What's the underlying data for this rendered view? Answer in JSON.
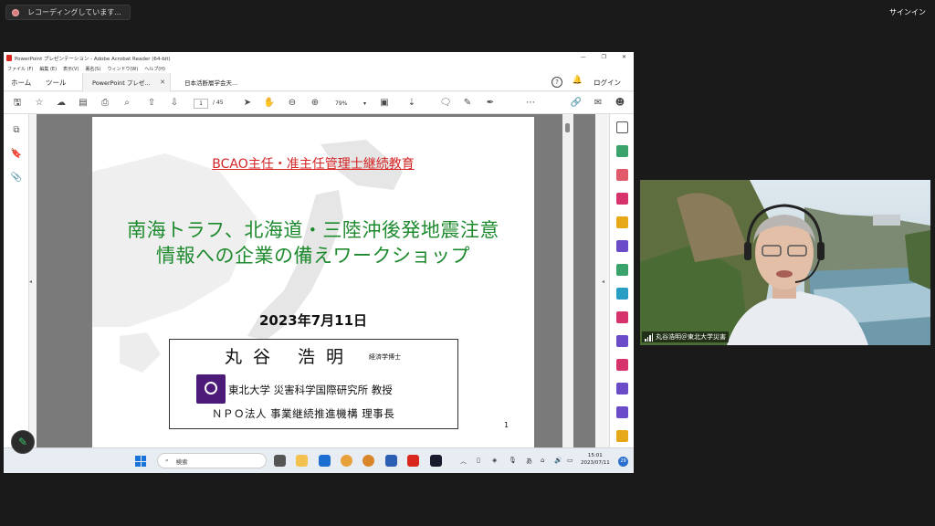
{
  "zoom": {
    "recording_label": "レコーディングしています...",
    "signin_label": "サインイン",
    "participant_name": "丸谷浩明＠東北大学災害"
  },
  "acrobat": {
    "window_title": "PowerPoint プレゼンテーション - Adobe Acrobat Reader (64-bit)",
    "menus": [
      "ファイル (F)",
      "編集 (E)",
      "表示(V)",
      "署名(S)",
      "ウィンドウ(W)",
      "ヘルプ(H)"
    ],
    "tabs": {
      "home": "ホーム",
      "tools": "ツール",
      "doc1": "PowerPoint プレゼ...",
      "doc2": "日本活断層学会天..."
    },
    "login_label": "ログイン",
    "help_glyph": "?",
    "page_current": "1",
    "page_total": "/ 45",
    "zoom_level": "79%"
  },
  "slide": {
    "subtitle": "BCAO主任・准主任管理士継続教育",
    "title_line1": "南海トラフ、北海道・三陸沖後発地震注意",
    "title_line2": "情報への企業の備えワークショップ",
    "date": "2023年7月11日",
    "presenter_name": "丸谷 浩明",
    "presenter_degree": "経済学博士",
    "affiliation1": "東北大学 災害科学国際研究所 教授",
    "affiliation2": "ＮＰＯ法人 事業継続推進機構 理事長",
    "page_number": "1"
  },
  "taskbar": {
    "search_label": "検索",
    "time": "15:01",
    "date": "2023/07/11",
    "notification_count": "29",
    "ime_label": "あ"
  },
  "colors": {
    "subtitle_red": "#d42424",
    "title_green": "#1d8a2e",
    "univ_purple": "#4c1a78"
  }
}
